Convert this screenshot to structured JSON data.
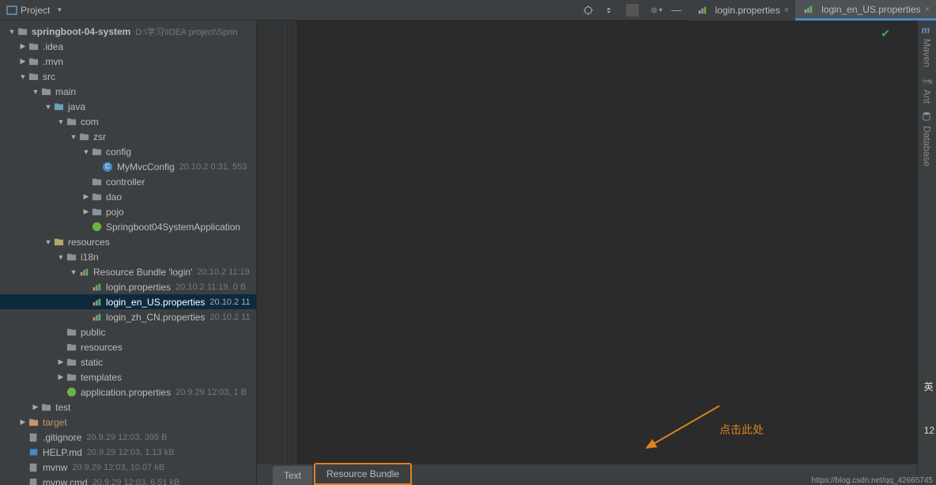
{
  "header": {
    "project_label": "Project"
  },
  "tabs": [
    {
      "label": "login.properties",
      "active": false
    },
    {
      "label": "login_en_US.properties",
      "active": true
    }
  ],
  "tree": {
    "root": {
      "name": "springboot-04-system",
      "path": "D:\\学习\\IDEA project\\Sprin"
    },
    "idea": ".idea",
    "mvn": ".mvn",
    "src": "src",
    "main": "main",
    "java": "java",
    "com": "com",
    "zsr": "zsr",
    "config": "config",
    "mymvc": "MyMvcConfig",
    "mymvc_meta": "20.10.2 0:31, 553",
    "controller": "controller",
    "dao": "dao",
    "pojo": "pojo",
    "springapp": "Springboot04SystemApplication",
    "resources": "resources",
    "i18n": "i18n",
    "bundle": "Resource Bundle 'login'",
    "bundle_meta": "20.10.2 11:19",
    "login_prop": "login.properties",
    "login_prop_meta": "20.10.2 11:19, 0 B",
    "login_en": "login_en_US.properties",
    "login_en_meta": "20.10.2 11",
    "login_zh": "login_zh_CN.properties",
    "login_zh_meta": "20.10.2 11",
    "public": "public",
    "resources2": "resources",
    "static": "static",
    "templates": "templates",
    "app_prop": "application.properties",
    "app_prop_meta": "20.9.29 12:03, 1 B",
    "test": "test",
    "target": "target",
    "gitignore": ".gitignore",
    "gitignore_meta": "20.9.29 12:03, 395 B",
    "help": "HELP.md",
    "help_meta": "20.9.29 12:03, 1.13 kB",
    "mvnw": "mvnw",
    "mvnw_meta": "20.9.29 12:03, 10.07 kB",
    "mvnwcmd": "mvnw.cmd",
    "mvnwcmd_meta": "20.9.29 12:03, 6.51 kB"
  },
  "bottom_tabs": {
    "text": "Text",
    "bundle": "Resource Bundle"
  },
  "annotation": "点击此处",
  "rail": {
    "maven": "Maven",
    "ant": "Ant",
    "database": "Database"
  },
  "far_right": {
    "lang": "英",
    "num": "12"
  },
  "watermark": "https://blog.csdn.net/qq_42665745"
}
